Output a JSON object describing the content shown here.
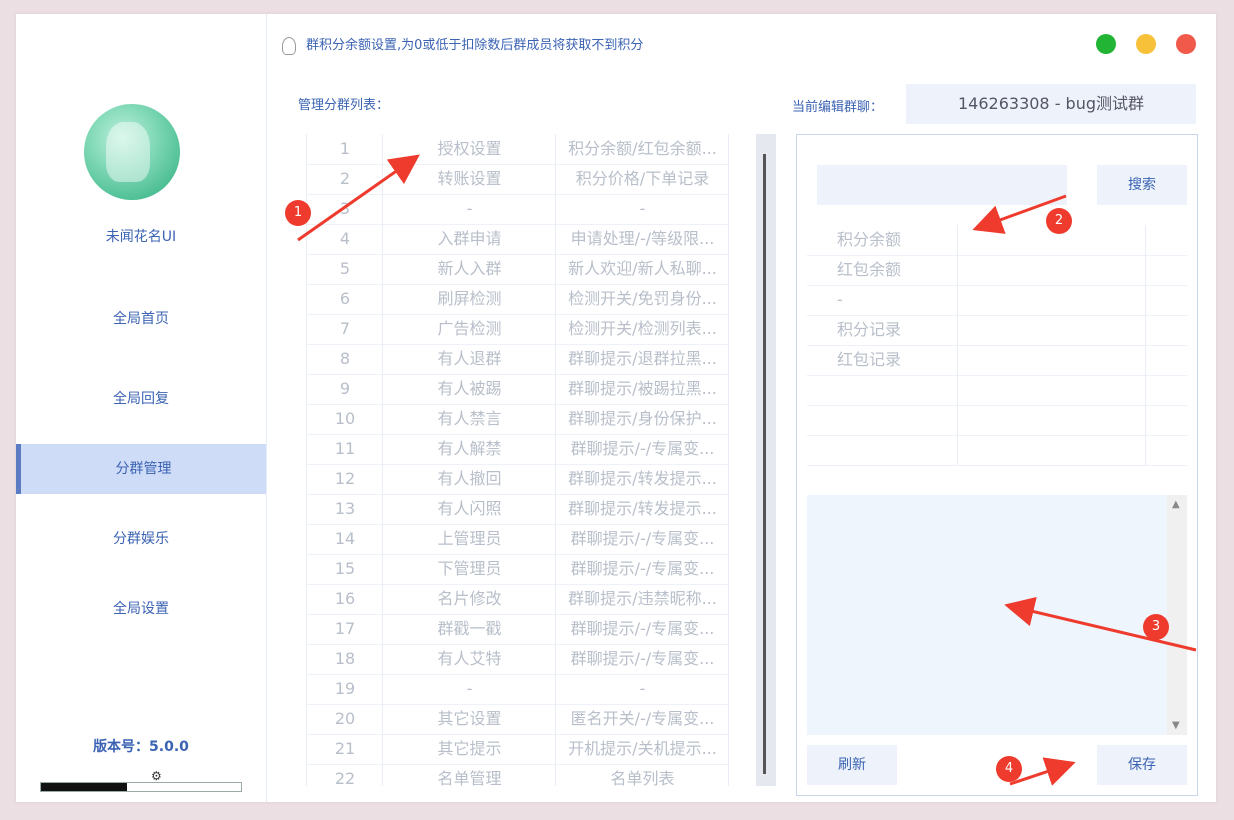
{
  "window": {
    "colors": {
      "green": "#22b535",
      "yellow": "#f7c23a",
      "red": "#f15a4b"
    }
  },
  "sidebar": {
    "username": "未闻花名UI",
    "items": [
      {
        "label": "全局首页"
      },
      {
        "label": "全局回复"
      },
      {
        "label": "分群管理",
        "active": true
      },
      {
        "label": "分群娱乐"
      },
      {
        "label": "全局设置"
      }
    ],
    "version_label": "版本号：5.0.0",
    "progress": 0.43
  },
  "header": {
    "tip": "群积分余额设置,为0或低于扣除数后群成员将获取不到积分"
  },
  "group_list": {
    "label": "管理分群列表：",
    "rows": [
      [
        "1",
        "授权设置",
        "积分余额/红包余额..."
      ],
      [
        "2",
        "转账设置",
        "积分价格/下单记录"
      ],
      [
        "3",
        "-",
        "-"
      ],
      [
        "4",
        "入群申请",
        "申请处理/-/等级限..."
      ],
      [
        "5",
        "新人入群",
        "新人欢迎/新人私聊..."
      ],
      [
        "6",
        "刷屏检测",
        "检测开关/免罚身份..."
      ],
      [
        "7",
        "广告检测",
        "检测开关/检测列表..."
      ],
      [
        "8",
        "有人退群",
        "群聊提示/退群拉黑..."
      ],
      [
        "9",
        "有人被踢",
        "群聊提示/被踢拉黑..."
      ],
      [
        "10",
        "有人禁言",
        "群聊提示/身份保护..."
      ],
      [
        "11",
        "有人解禁",
        "群聊提示/-/专属变..."
      ],
      [
        "12",
        "有人撤回",
        "群聊提示/转发提示..."
      ],
      [
        "13",
        "有人闪照",
        "群聊提示/转发提示..."
      ],
      [
        "14",
        "上管理员",
        "群聊提示/-/专属变..."
      ],
      [
        "15",
        "下管理员",
        "群聊提示/-/专属变..."
      ],
      [
        "16",
        "名片修改",
        "群聊提示/违禁昵称..."
      ],
      [
        "17",
        "群戳一戳",
        "群聊提示/-/专属变..."
      ],
      [
        "18",
        "有人艾特",
        "群聊提示/-/专属变..."
      ],
      [
        "19",
        "-",
        "-"
      ],
      [
        "20",
        "其它设置",
        "匿名开关/-/专属变..."
      ],
      [
        "21",
        "其它提示",
        "开机提示/关机提示..."
      ],
      [
        "22",
        "名单管理",
        "名单列表"
      ]
    ]
  },
  "editor": {
    "current_label": "当前编辑群聊：",
    "current_group": "146263308 - bug测试群",
    "search_button": "搜索",
    "rows": [
      "积分余额",
      "红包余额",
      "-",
      "积分记录",
      "红包记录",
      "",
      "",
      ""
    ],
    "refresh_button": "刷新",
    "save_button": "保存"
  },
  "annotations": [
    "1",
    "2",
    "3",
    "4"
  ]
}
